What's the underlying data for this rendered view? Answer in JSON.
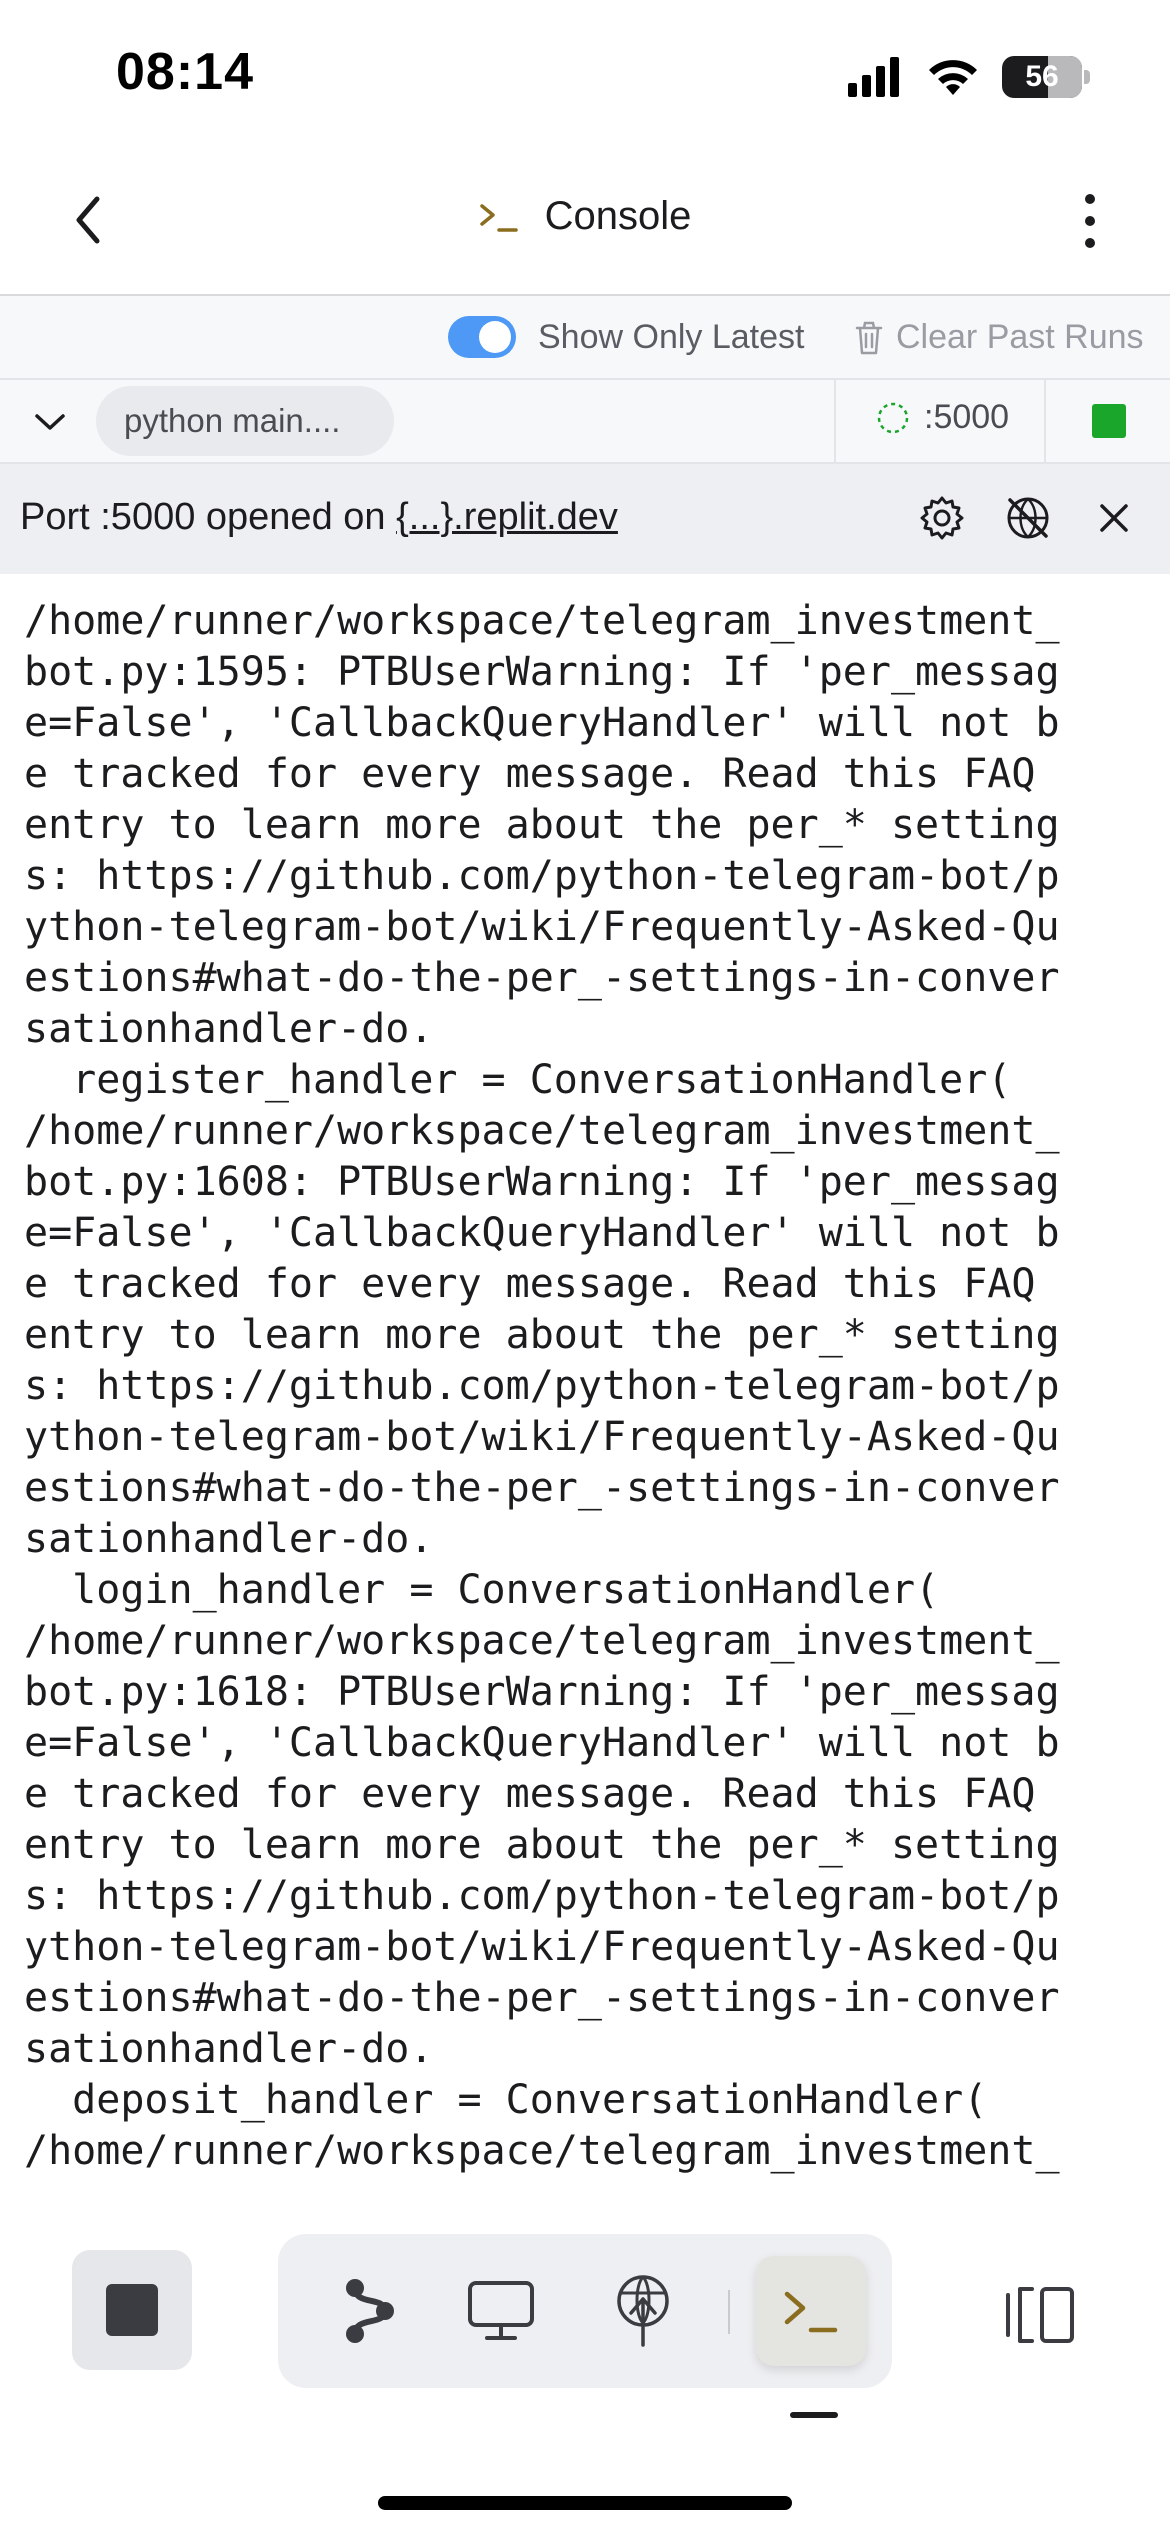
{
  "status_bar": {
    "time": "08:14",
    "battery": "56"
  },
  "header": {
    "title": "Console",
    "title_icon": "terminal-icon"
  },
  "toolbar": {
    "toggle_label": "Show Only Latest",
    "toggle_on": true,
    "clear_label": "Clear Past Runs"
  },
  "run": {
    "command": "python main....",
    "port": ":5000",
    "status_color": "#1aa52b"
  },
  "port_banner": {
    "prefix": "Port :5000 opened on ",
    "link": "{...}.replit.dev"
  },
  "console": {
    "output": "/home/runner/workspace/telegram_investment_\nbot.py:1595: PTBUserWarning: If 'per_messag\ne=False', 'CallbackQueryHandler' will not b\ne tracked for every message. Read this FAQ\nentry to learn more about the per_* setting\ns: https://github.com/python-telegram-bot/p\nython-telegram-bot/wiki/Frequently-Asked-Qu\nestions#what-do-the-per_-settings-in-conver\nsationhandler-do.\n  register_handler = ConversationHandler(\n/home/runner/workspace/telegram_investment_\nbot.py:1608: PTBUserWarning: If 'per_messag\ne=False', 'CallbackQueryHandler' will not b\ne tracked for every message. Read this FAQ\nentry to learn more about the per_* setting\ns: https://github.com/python-telegram-bot/p\nython-telegram-bot/wiki/Frequently-Asked-Qu\nestions#what-do-the-per_-settings-in-conver\nsationhandler-do.\n  login_handler = ConversationHandler(\n/home/runner/workspace/telegram_investment_\nbot.py:1618: PTBUserWarning: If 'per_messag\ne=False', 'CallbackQueryHandler' will not b\ne tracked for every message. Read this FAQ\nentry to learn more about the per_* setting\ns: https://github.com/python-telegram-bot/p\nython-telegram-bot/wiki/Frequently-Asked-Qu\nestions#what-do-the-per_-settings-in-conver\nsationhandler-do.\n  deposit_handler = ConversationHandler(\n/home/runner/workspace/telegram_investment_"
  },
  "bottom_bar": {
    "tabs": [
      {
        "icon": "git-branch-icon"
      },
      {
        "icon": "monitor-icon"
      },
      {
        "icon": "deploy-antenna-icon"
      },
      {
        "icon": "terminal-icon",
        "active": true
      }
    ],
    "accent": "#8a6d1e"
  }
}
